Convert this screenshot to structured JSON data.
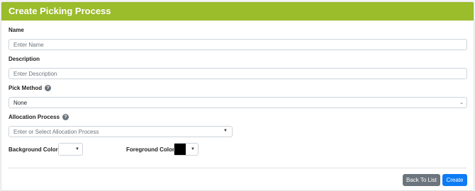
{
  "header": {
    "title": "Create Picking Process"
  },
  "form": {
    "name": {
      "label": "Name",
      "placeholder": "Enter Name"
    },
    "description": {
      "label": "Description",
      "placeholder": "Enter Description"
    },
    "pick_method": {
      "label": "Pick Method",
      "selected": "None",
      "help_icon": "question-circle-icon"
    },
    "allocation_process": {
      "label": "Allocation Process",
      "placeholder": "Enter or Select Allocation Process",
      "help_icon": "question-circle-icon"
    },
    "background_color": {
      "label": "Background Color",
      "value": "#ffffff"
    },
    "foreground_color": {
      "label": "Foreground Color",
      "value": "#000000"
    }
  },
  "actions": {
    "back_label": "Back To List",
    "create_label": "Create"
  },
  "colors": {
    "header": "#9bbc2b",
    "primary": "#0d7bf5",
    "secondary": "#6c757d"
  }
}
